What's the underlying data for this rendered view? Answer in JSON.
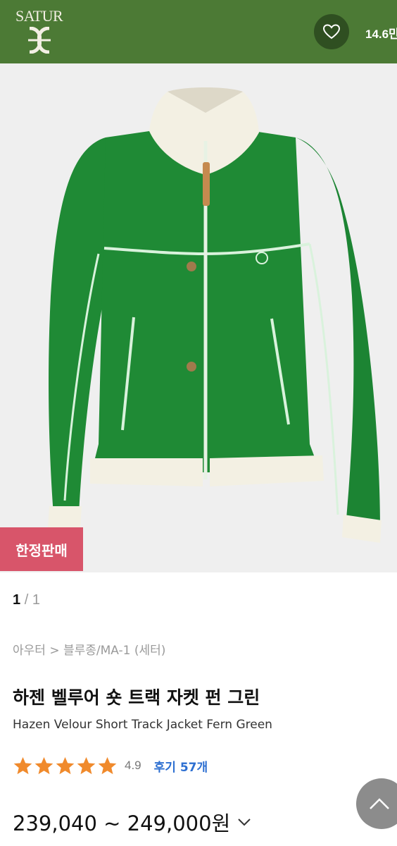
{
  "header": {
    "brand": "SATUR",
    "like_count": "14.6만"
  },
  "icons": {
    "logo": "satur-knot-logo",
    "like": "heart-outline-icon",
    "stars": "star-icon",
    "price_toggle": "chevron-down-icon",
    "scroll_top": "chevron-up-icon"
  },
  "colors": {
    "header_bg": "#4c7a35",
    "badge_bg": "#d8556a",
    "star": "#f08a2c",
    "review_link": "#2d6fd1",
    "jacket": "#1f8a35"
  },
  "product": {
    "badge": "한정판매",
    "pager": {
      "current": "1",
      "separator": "/",
      "total": "1"
    },
    "breadcrumb": "아우터 > 블루종/MA-1 (세터)",
    "title_ko": "하젠 벨루어 숏 트랙 자켓 펀 그린",
    "title_en": "Hazen Velour Short Track Jacket Fern Green",
    "rating": {
      "stars": 5,
      "value": "4.9",
      "reviews_label": "후기 57개"
    },
    "price": "239,040 ~ 249,000원"
  }
}
